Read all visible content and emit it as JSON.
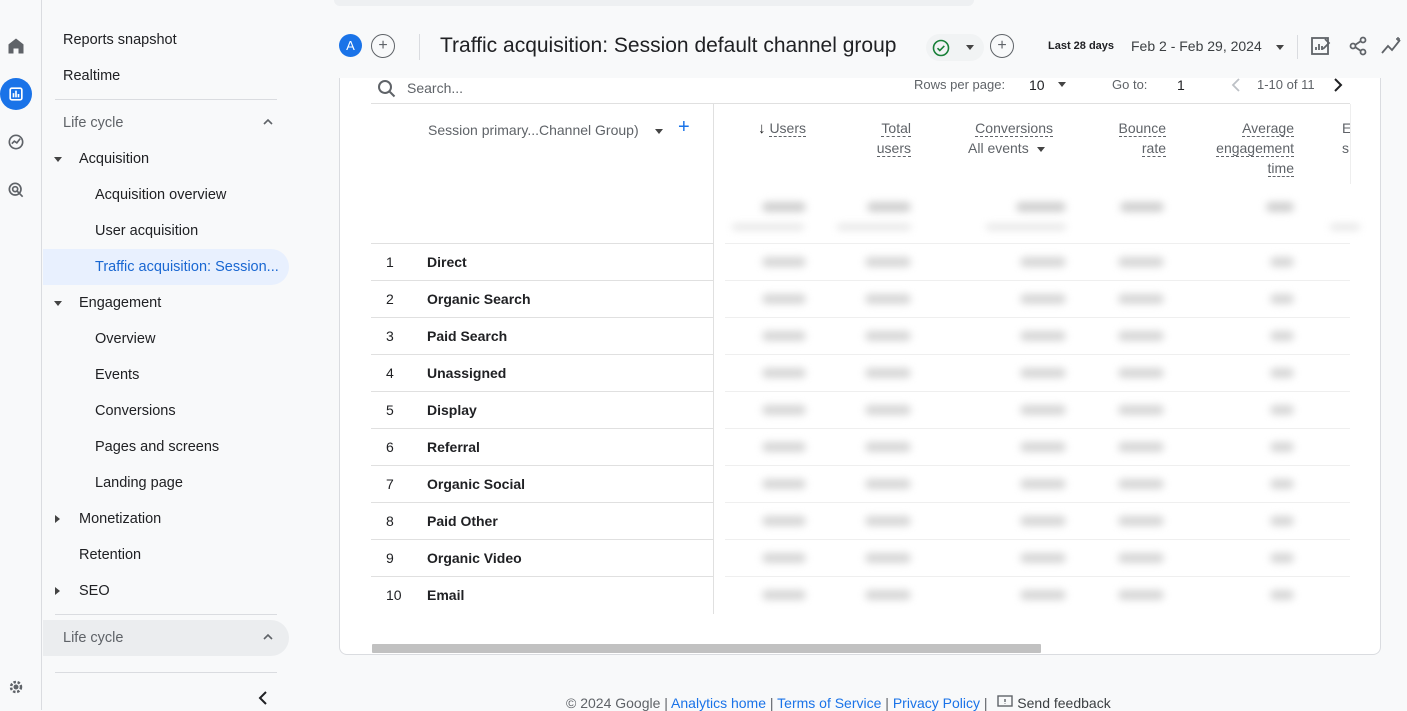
{
  "nav": {
    "reports_snapshot": "Reports snapshot",
    "realtime": "Realtime",
    "section1": "Life cycle",
    "acquisition": "Acquisition",
    "acquisition_overview": "Acquisition overview",
    "user_acquisition": "User acquisition",
    "traffic_acquisition": "Traffic acquisition: Session...",
    "engagement": "Engagement",
    "overview": "Overview",
    "events": "Events",
    "conversions": "Conversions",
    "pages_and_screens": "Pages and screens",
    "landing_page": "Landing page",
    "monetization": "Monetization",
    "retention": "Retention",
    "seo": "SEO",
    "section2": "Life cycle"
  },
  "header": {
    "avatar_letter": "A",
    "title": "Traffic acquisition: Session default channel group",
    "date_preset": "Last 28 days",
    "date_range": "Feb 2 - Feb 29, 2024"
  },
  "toolbar": {
    "search_placeholder": "Search...",
    "rows_per_page_label": "Rows per page:",
    "rows_per_page_value": "10",
    "goto_label": "Go to:",
    "goto_value": "1",
    "pagination": "1-10 of 11"
  },
  "table": {
    "dimension_header": "Session primary...Channel Group)",
    "metrics": {
      "users": "Users",
      "total_users_1": "Total",
      "total_users_2": "users",
      "conversions": "Conversions",
      "conversions_sub": "All events",
      "bounce_1": "Bounce",
      "bounce_2": "rate",
      "avg_1": "Average",
      "avg_2": "engagement",
      "avg_3": "time",
      "cut_1": "E",
      "cut_2": "s"
    },
    "rows": [
      {
        "num": "1",
        "name": "Direct"
      },
      {
        "num": "2",
        "name": "Organic Search"
      },
      {
        "num": "3",
        "name": "Paid Search"
      },
      {
        "num": "4",
        "name": "Unassigned"
      },
      {
        "num": "5",
        "name": "Display"
      },
      {
        "num": "6",
        "name": "Referral"
      },
      {
        "num": "7",
        "name": "Organic Social"
      },
      {
        "num": "8",
        "name": "Paid Other"
      },
      {
        "num": "9",
        "name": "Organic Video"
      },
      {
        "num": "10",
        "name": "Email"
      }
    ]
  },
  "footer": {
    "copyright": "© 2024 Google |",
    "analytics_home": "Analytics home",
    "sep1": "|",
    "terms": "Terms of Service",
    "sep2": "|",
    "privacy": "Privacy Policy",
    "sep3": "|",
    "feedback": "Send feedback"
  },
  "colors": {
    "accent": "#1a73e8",
    "active_bg": "#e8f0fe",
    "success": "#188038"
  }
}
